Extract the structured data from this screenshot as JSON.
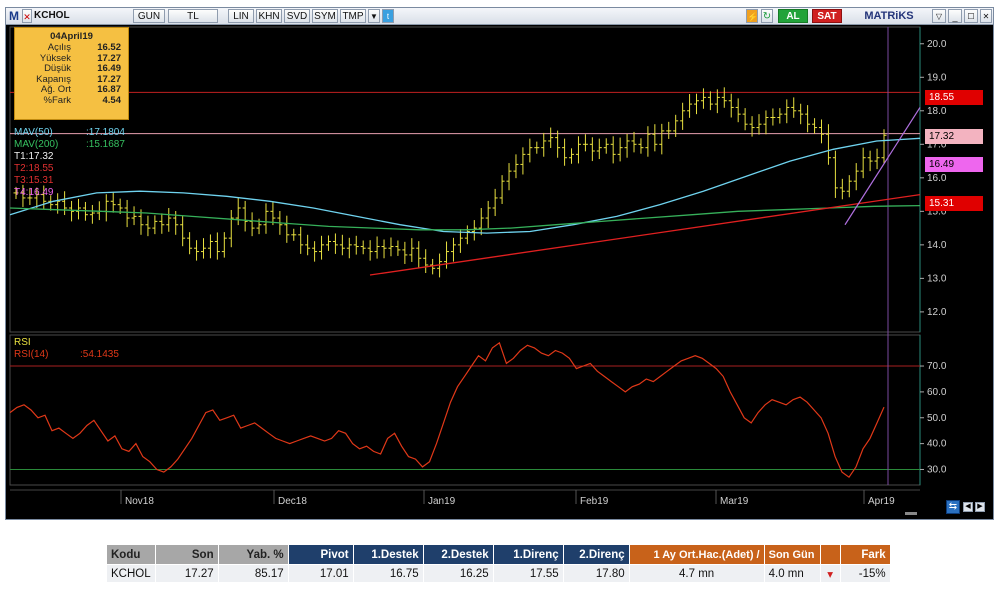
{
  "toolbar": {
    "logo": "M",
    "symbol": "KCHOL",
    "buttons": [
      "GUN",
      "TL",
      "LIN",
      "KHN",
      "SVD",
      "SYM",
      "TMP"
    ],
    "buy_label": "AL",
    "sell_label": "SAT",
    "brand": "MATRiKS"
  },
  "tooltip": {
    "date": "04April19",
    "rows": [
      {
        "label": "Açılış",
        "value": "16.52"
      },
      {
        "label": "Yüksek",
        "value": "17.27"
      },
      {
        "label": "Düşük",
        "value": "16.49"
      },
      {
        "label": "Kapanış",
        "value": "17.27"
      },
      {
        "label": "Ağ. Ort",
        "value": "16.87"
      },
      {
        "label": "%Fark",
        "value": "4.54"
      }
    ]
  },
  "indicators": {
    "mav50": "MAV(50)",
    "mav50_value": ":17.1804",
    "mav200": "MAV(200)",
    "mav200_value": ":15.1687",
    "t1": "T1:17.32",
    "t2": "T2:18.55",
    "t3": "T3:15.31",
    "t4": "T4:16.49",
    "rsi_title": "RSI",
    "rsi_label": "RSI(14)",
    "rsi_value": ":54.1435"
  },
  "price_boxes": [
    {
      "text": "18.55",
      "bg": "#e00000",
      "fg": "#ffffff",
      "value": 18.55
    },
    {
      "text": "17.32",
      "bg": "#f3b3c0",
      "fg": "#000000",
      "value": 17.32
    },
    {
      "text": "16.49",
      "bg": "#ee66ee",
      "fg": "#000000",
      "value": 16.49
    },
    {
      "text": "15.31",
      "bg": "#e00000",
      "fg": "#ffffff",
      "value": 15.31
    }
  ],
  "chart_data": {
    "type": "line",
    "symbol": "KCHOL",
    "x_labels": [
      "Nov18",
      "Dec18",
      "Jan19",
      "Feb19",
      "Mar19",
      "Apr19"
    ],
    "price_axis": {
      "ticks": [
        12.0,
        13.0,
        14.0,
        15.0,
        16.0,
        17.0,
        18.0,
        19.0,
        20.0
      ],
      "ylim": [
        11.4,
        20.5
      ]
    },
    "rsi_axis": {
      "ticks": [
        30.0,
        40.0,
        50.0,
        60.0,
        70.0
      ],
      "ylim": [
        24,
        82
      ],
      "levels": [
        30,
        70
      ]
    },
    "series": [
      {
        "name": "Close",
        "color": "#e8e040",
        "values": [
          15.55,
          15.4,
          15.4,
          15.5,
          15.3,
          15.2,
          15.3,
          15.1,
          15.0,
          15.1,
          14.9,
          14.95,
          15.0,
          15.3,
          15.2,
          15.1,
          14.8,
          14.85,
          14.6,
          14.5,
          14.7,
          14.6,
          14.8,
          14.6,
          14.2,
          13.9,
          13.8,
          13.9,
          14.1,
          13.8,
          14.2,
          14.8,
          15.1,
          14.7,
          14.5,
          14.6,
          15.0,
          14.8,
          14.6,
          14.3,
          14.3,
          14.0,
          13.9,
          13.8,
          14.0,
          14.1,
          14.0,
          13.9,
          14.0,
          13.95,
          13.9,
          13.8,
          13.95,
          13.9,
          13.95,
          13.85,
          13.7,
          13.9,
          13.6,
          13.4,
          13.3,
          13.5,
          13.8,
          14.0,
          14.2,
          14.4,
          14.5,
          14.8,
          15.1,
          15.4,
          15.9,
          16.2,
          16.4,
          16.7,
          16.9,
          16.9,
          17.1,
          17.2,
          16.9,
          16.6,
          16.7,
          17.0,
          17.0,
          16.8,
          16.9,
          17.0,
          16.7,
          16.9,
          17.1,
          17.0,
          16.9,
          17.3,
          17.0,
          17.4,
          17.4,
          17.7,
          18.0,
          18.2,
          18.3,
          18.4,
          18.2,
          18.4,
          18.3,
          18.1,
          17.9,
          17.6,
          17.5,
          17.6,
          17.8,
          17.8,
          17.9,
          18.1,
          18.0,
          17.9,
          17.6,
          17.5,
          17.3,
          16.6,
          15.7,
          15.6,
          15.9,
          16.2,
          16.6,
          16.5,
          16.6,
          17.27
        ]
      },
      {
        "name": "MAV(50)",
        "color": "#6fd3ef",
        "values": [
          14.9,
          15.3,
          15.55,
          15.6,
          15.55,
          15.45,
          15.3,
          15.1,
          14.85,
          14.6,
          14.4,
          14.35,
          14.4,
          14.6,
          14.85,
          15.2,
          15.6,
          16.05,
          16.5,
          16.85,
          17.1,
          17.18
        ]
      },
      {
        "name": "MAV(200)",
        "color": "#36b05a",
        "values": [
          15.1,
          15.05,
          15.0,
          14.95,
          14.85,
          14.75,
          14.65,
          14.55,
          14.5,
          14.45,
          14.45,
          14.5,
          14.6,
          14.7,
          14.8,
          14.9,
          15.0,
          15.05,
          15.1,
          15.15,
          15.17
        ]
      }
    ],
    "rsi": {
      "name": "RSI(14)",
      "color": "#e03818",
      "values": [
        52,
        54,
        55,
        53,
        50,
        51,
        45,
        46,
        44,
        42,
        44,
        47,
        49,
        45,
        41,
        43,
        38,
        37,
        40,
        35,
        33,
        30,
        29,
        31,
        34,
        38,
        42,
        47,
        52,
        53,
        49,
        50,
        51,
        46,
        47,
        48,
        46,
        44,
        42,
        41,
        40,
        41,
        42,
        43,
        42,
        41,
        42,
        45,
        44,
        40,
        38,
        39,
        37,
        36,
        42,
        44,
        39,
        35,
        34,
        31,
        33,
        40,
        48,
        56,
        62,
        66,
        70,
        74,
        72,
        77,
        79,
        71,
        73,
        76,
        78,
        77,
        75,
        74,
        76,
        75,
        73,
        69,
        70,
        71,
        68,
        66,
        64,
        62,
        60,
        62,
        63,
        65,
        64,
        66,
        68,
        70,
        72,
        73,
        74,
        73,
        71,
        69,
        66,
        60,
        55,
        50,
        48,
        52,
        55,
        57,
        56,
        55,
        57,
        58,
        56,
        53,
        50,
        44,
        35,
        29,
        27,
        31,
        38,
        42,
        48,
        54.14
      ]
    }
  },
  "table": {
    "headers": [
      "Kodu",
      "Son",
      "Yab. %",
      "Pivot",
      "1.Destek",
      "2.Destek",
      "1.Direnç",
      "2.Direnç",
      "1 Ay Ort.Hac.(Adet) /",
      "Son Gün",
      "",
      "Fark"
    ],
    "row": [
      "KCHOL",
      "17.27",
      "85.17",
      "17.01",
      "16.75",
      "16.25",
      "17.55",
      "17.80",
      "4.7 mn",
      "4.0 mn",
      "▾",
      "-15%"
    ]
  },
  "colors": {
    "background": "#000000",
    "frame": "#7a8aa0",
    "axis": "#d0d0d0",
    "hline_red": "#c22",
    "hline_pink": "#e8a0b0",
    "trend_red": "#e02020",
    "trend_purple": "#b070e0"
  }
}
